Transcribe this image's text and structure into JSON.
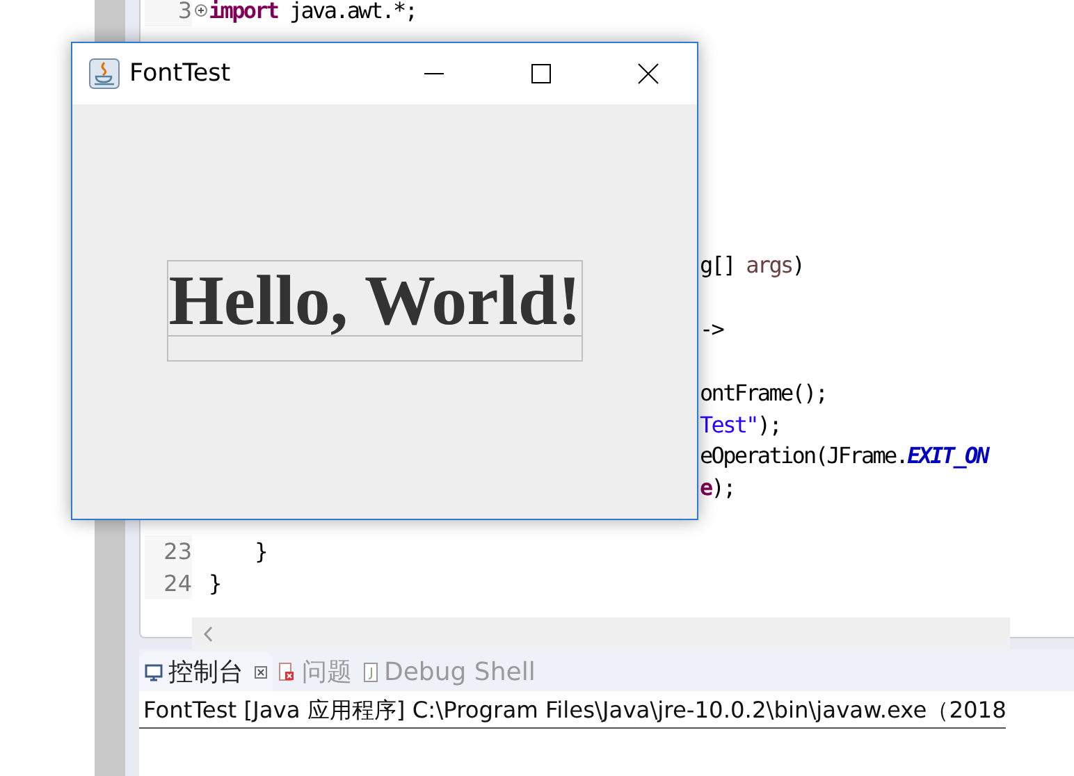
{
  "editor": {
    "top_lines": [
      {
        "number": "3",
        "folded": true,
        "tokens": [
          {
            "kind": "keyword",
            "text": "import"
          },
          {
            "kind": "plain",
            "text": " java.awt.*;"
          }
        ]
      }
    ],
    "fragments": [
      {
        "tokens": [
          {
            "kind": "plain",
            "text": "g[] "
          },
          {
            "kind": "variable",
            "text": "args"
          },
          {
            "kind": "plain",
            "text": ")"
          }
        ]
      },
      {
        "tokens": [
          {
            "kind": "plain",
            "text": "->"
          }
        ]
      },
      {
        "tokens": [
          {
            "kind": "plain",
            "text": "ontFrame();"
          }
        ]
      },
      {
        "tokens": [
          {
            "kind": "string",
            "text": "Test\""
          },
          {
            "kind": "plain",
            "text": ");"
          }
        ]
      },
      {
        "tokens": [
          {
            "kind": "plain",
            "text": "eOperation(JFrame."
          },
          {
            "kind": "constant",
            "text": "EXIT_ON"
          }
        ]
      },
      {
        "tokens": [
          {
            "kind": "keyword",
            "text": "e"
          },
          {
            "kind": "plain",
            "text": ");"
          }
        ]
      }
    ],
    "bottom_lines": [
      {
        "number": "23",
        "tokens": [
          {
            "kind": "plain",
            "text": "    }"
          }
        ]
      },
      {
        "number": "24",
        "tokens": [
          {
            "kind": "plain",
            "text": "}"
          }
        ]
      }
    ]
  },
  "console": {
    "tabs": [
      {
        "label": "控制台",
        "selected": true,
        "kind": "console"
      },
      {
        "label": "问题",
        "selected": false,
        "kind": "problems"
      },
      {
        "label": "Debug Shell",
        "selected": false,
        "kind": "shell"
      }
    ],
    "status": "FontTest [Java 应用程序] C:\\Program Files\\Java\\jre-10.0.2\\bin\\javaw.exe（2018"
  },
  "window": {
    "title": "FontTest",
    "label": "Hello, World!"
  }
}
